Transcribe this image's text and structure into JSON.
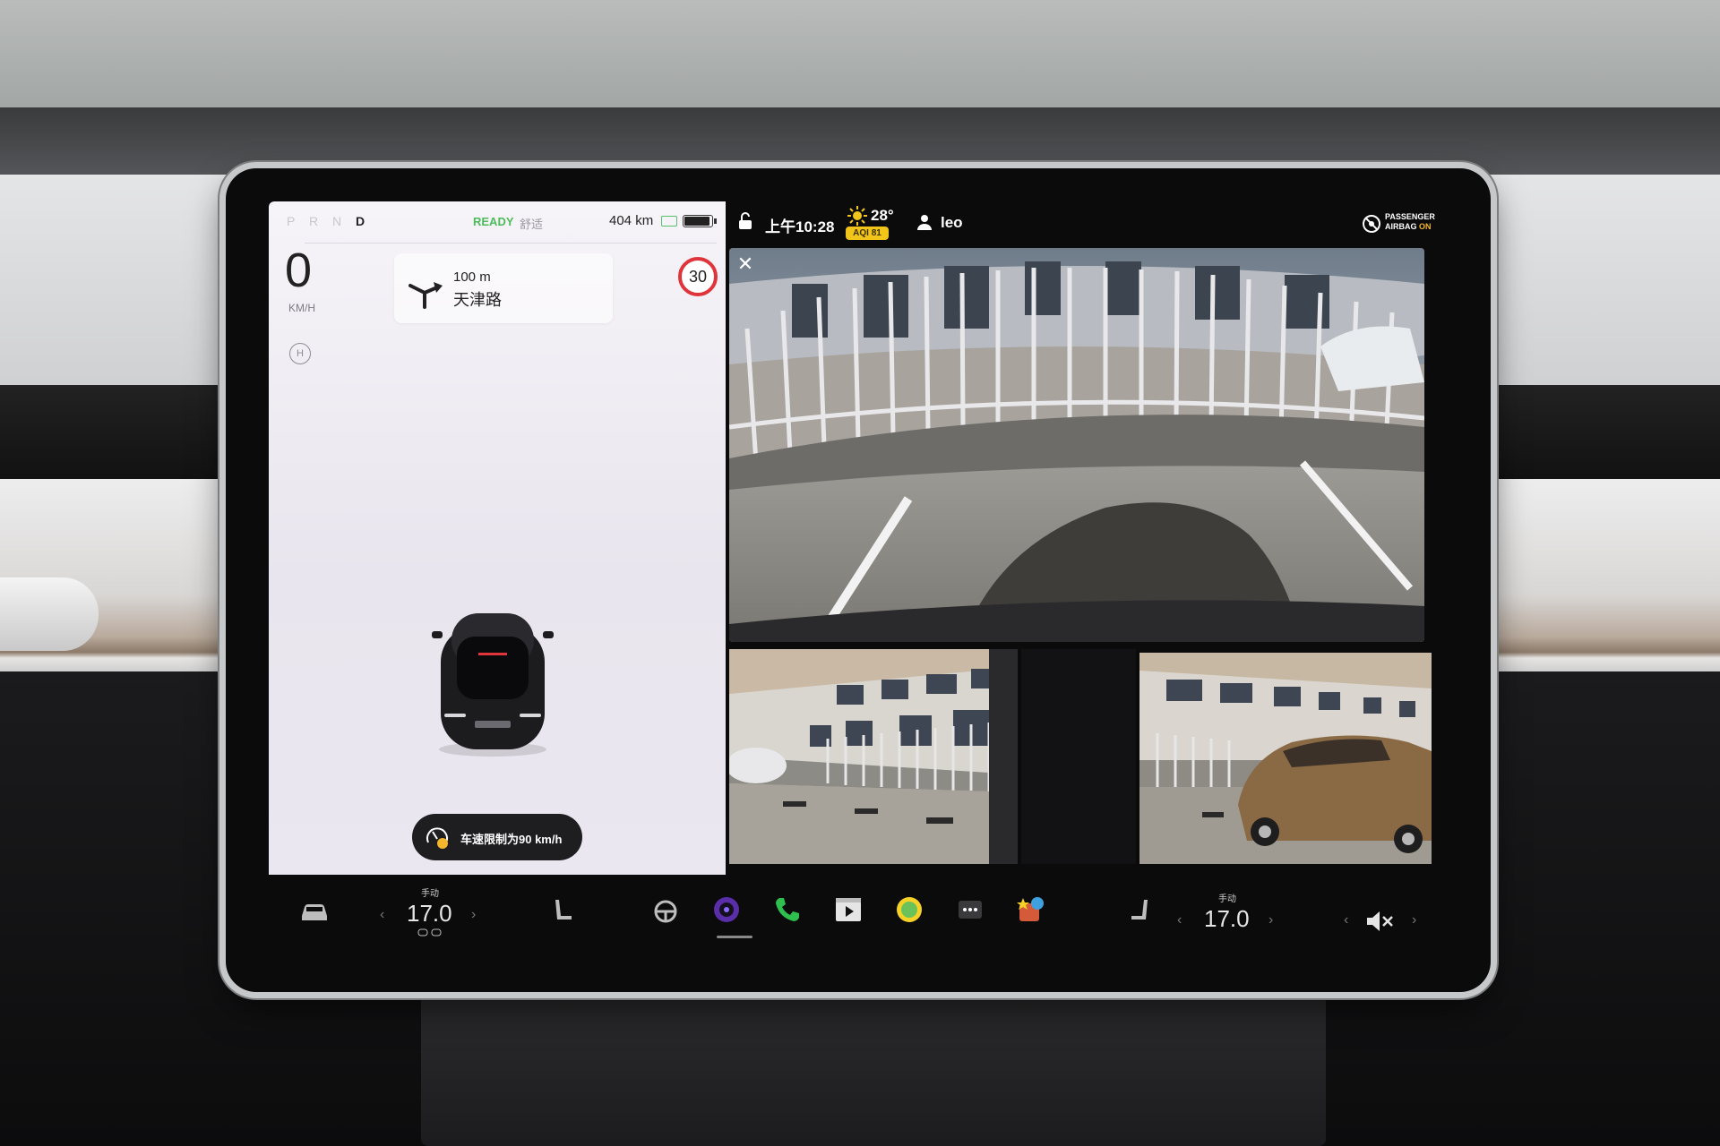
{
  "drive_panel": {
    "gear_inactive": "P R N",
    "gear_active": "D",
    "status_ready": "READY",
    "drive_mode": "舒适",
    "range": "404 km",
    "speed": "0",
    "speed_unit": "KM/H",
    "hold_label": "H",
    "nav_distance": "100 m",
    "nav_road": "天津路",
    "speed_limit": "30",
    "limit_notice": "车速限制为90 km/h"
  },
  "status_bar": {
    "time": "上午10:28",
    "temperature": "28°",
    "aqi": "AQI 81",
    "user": "leo",
    "airbag_line1": "PASSENGER",
    "airbag_line2_a": "AIRBAG ",
    "airbag_line2_b": "ON"
  },
  "camera": {
    "close_label": "✕"
  },
  "dock": {
    "left_temp_mode": "手动",
    "left_temp": "17.0",
    "right_temp_mode": "手动",
    "right_temp": "17.0",
    "icons": [
      "car-icon",
      "left-seat-heater-icon",
      "steering-heater-icon",
      "camera-app-icon",
      "phone-icon",
      "media-player-icon",
      "toybox-icon",
      "more-apps-icon",
      "games-icon",
      "right-seat-heater-icon",
      "volume-mute-icon"
    ]
  },
  "colors": {
    "ready_green": "#4ebc5a",
    "speed_limit_red": "#e0343b",
    "aqi_yellow": "#f0c419",
    "airbag_on_orange": "#f3b62c",
    "phone_green": "#2fbf4f"
  }
}
